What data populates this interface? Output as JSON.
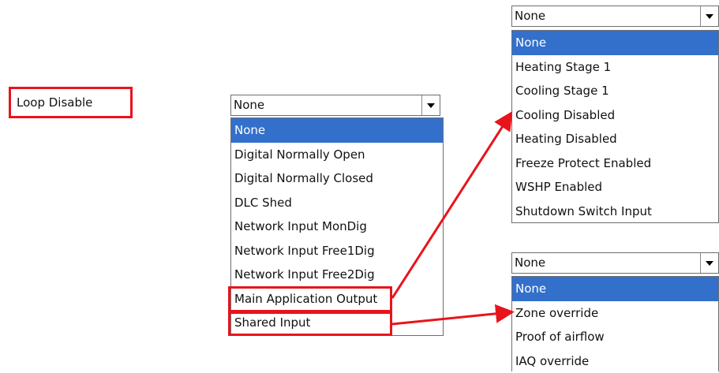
{
  "loop_label": "Loop Disable",
  "dropdown_main": {
    "selected": "None",
    "options": [
      "None",
      "Digital Normally Open",
      "Digital Normally Closed",
      "DLC Shed",
      "Network Input MonDig",
      "Network Input Free1Dig",
      "Network Input Free2Dig",
      "Main Application Output",
      "Shared Input"
    ]
  },
  "dropdown_output": {
    "selected": "None",
    "options": [
      "None",
      "Heating Stage 1",
      "Cooling Stage 1",
      "Cooling Disabled",
      "Heating Disabled",
      "Freeze Protect Enabled",
      "WSHP Enabled",
      "Shutdown Switch Input"
    ]
  },
  "dropdown_shared": {
    "selected": "None",
    "options": [
      "None",
      "Zone override",
      "Proof of airflow",
      "IAQ override"
    ]
  },
  "colors": {
    "highlight": "#e8141c",
    "selection": "#3370cb"
  }
}
